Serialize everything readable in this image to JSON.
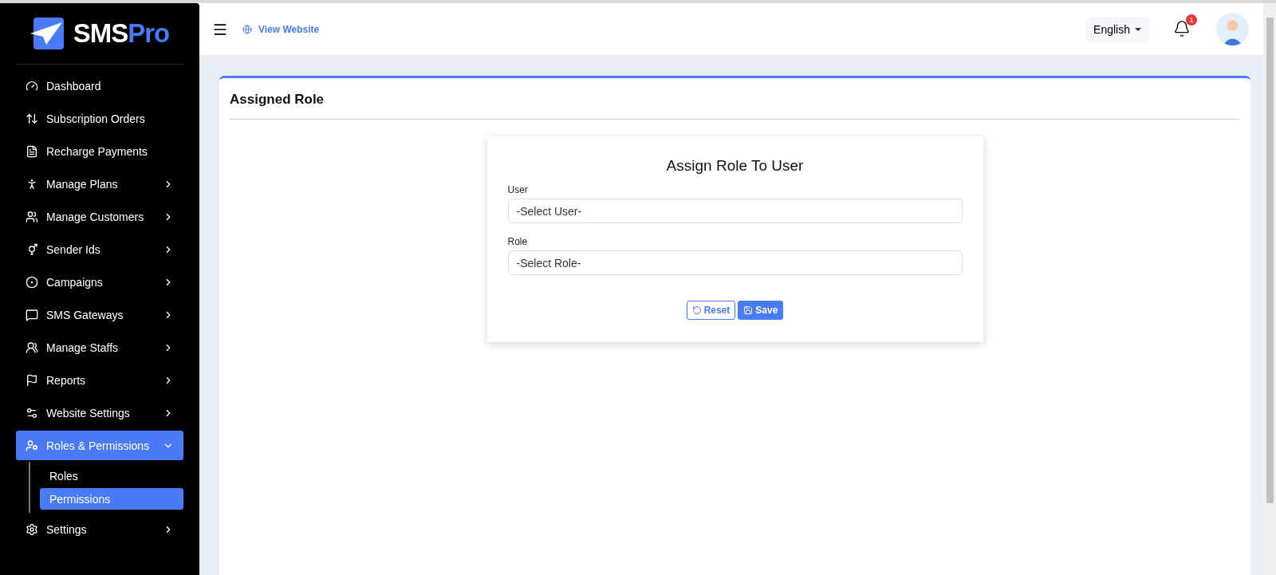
{
  "brand": {
    "first": "SMS",
    "second": "Pro"
  },
  "sidebar": {
    "items": [
      {
        "label": "Dashboard",
        "selected": false
      },
      {
        "label": "Subscription Orders",
        "selected": false
      },
      {
        "label": "Recharge Payments",
        "selected": false
      },
      {
        "label": "Manage Plans",
        "selected": false,
        "expanded": false
      },
      {
        "label": "Manage Customers",
        "selected": false,
        "expanded": false
      },
      {
        "label": "Sender Ids",
        "selected": false,
        "expanded": false
      },
      {
        "label": "Campaigns",
        "selected": false,
        "expanded": false
      },
      {
        "label": "SMS Gateways",
        "selected": false,
        "expanded": false
      },
      {
        "label": "Manage Staffs",
        "selected": false,
        "expanded": false
      },
      {
        "label": "Reports",
        "selected": false,
        "expanded": false
      },
      {
        "label": "Website Settings",
        "selected": false,
        "expanded": false
      },
      {
        "label": "Roles & Permissions",
        "selected": true,
        "expanded": true,
        "children": [
          {
            "label": "Roles",
            "selected": false
          },
          {
            "label": "Permissions",
            "selected": true
          }
        ]
      },
      {
        "label": "Settings",
        "selected": false,
        "expanded": false
      }
    ]
  },
  "header": {
    "link": "View Website",
    "language": "English",
    "notifications": "1"
  },
  "page": {
    "title": "Assigned Role",
    "form": {
      "title": "Assign Role To User",
      "fields": [
        {
          "label": "User",
          "placeholder": "-Select User-"
        },
        {
          "label": "Role",
          "placeholder": "-Select Role-"
        }
      ],
      "buttons": [
        {
          "label": "Reset",
          "kind": "outline"
        },
        {
          "label": "Save",
          "kind": "primary"
        }
      ]
    }
  }
}
